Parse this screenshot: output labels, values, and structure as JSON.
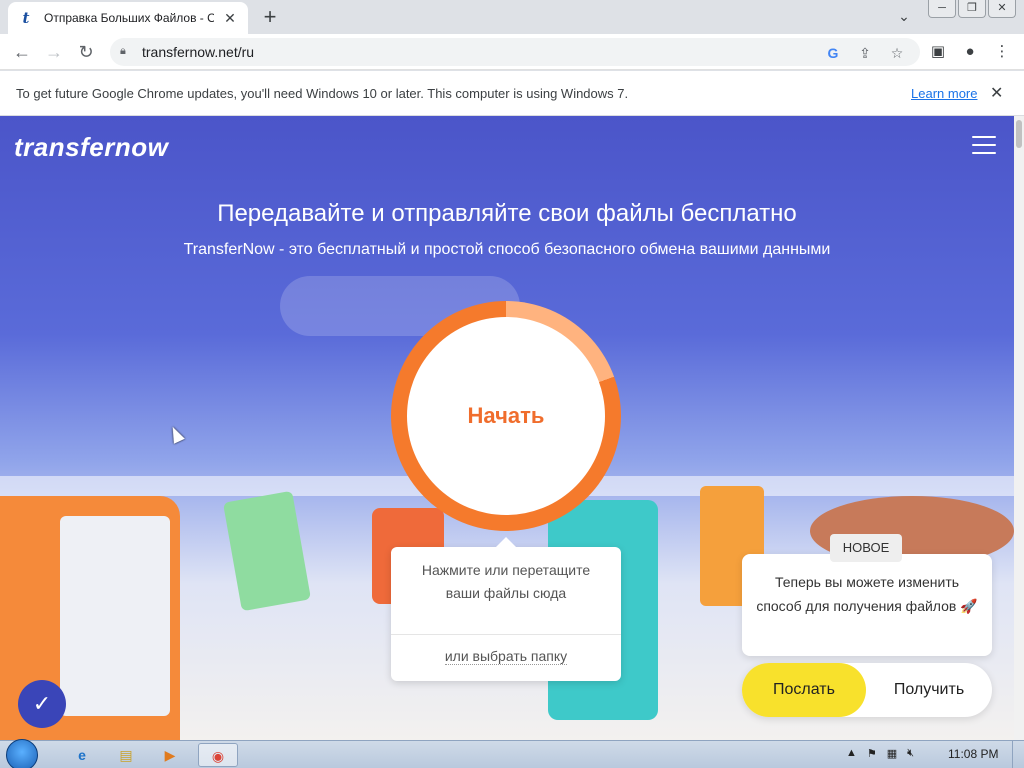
{
  "browser": {
    "tab_title": "Отправка Больших Файлов - Оп",
    "tab_favicon": "t",
    "url": "transfernow.net/ru",
    "infobar_message": "To get future Google Chrome updates, you'll need Windows 10 or later. This computer is using Windows 7.",
    "infobar_link": "Learn more"
  },
  "page": {
    "logo": "transfernow",
    "headline": "Передавайте и отправляйте свои файлы бесплатно",
    "subheadline": "TransferNow - это бесплатный и простой способ безопасного обмена вашими данными",
    "start_button": "Начать",
    "drop_hint": "Нажмите или перетащите ваши файлы сюда",
    "choose_folder": "или выбрать папку",
    "new_badge": "НОВОЕ",
    "new_feature_text": "Теперь вы можете изменить способ для получения файлов 🚀",
    "send_label": "Послать",
    "receive_label": "Получить"
  },
  "taskbar": {
    "clock": "11:08 PM"
  },
  "colors": {
    "accent_orange": "#f06d2c",
    "send_yellow": "#f8e12c",
    "page_blue": "#4b55c9"
  }
}
